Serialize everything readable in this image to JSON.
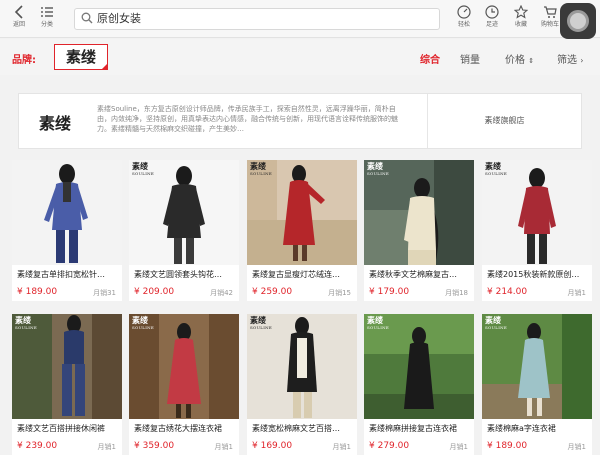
{
  "toolbar": {
    "back_label": "返回",
    "category_label": "分类",
    "right_buttons": [
      {
        "label": "轻松",
        "icon": "speedometer-icon"
      },
      {
        "label": "足迹",
        "icon": "clock-icon"
      },
      {
        "label": "收藏",
        "icon": "star-icon"
      },
      {
        "label": "购物车",
        "icon": "cart-icon"
      }
    ]
  },
  "search": {
    "query": "原创女装"
  },
  "filter": {
    "brand_label": "品牌",
    "brand_logo": "素缕",
    "sorts": [
      {
        "label": "综合",
        "active": true
      },
      {
        "label": "销量",
        "active": false
      },
      {
        "label": "价格",
        "active": false
      },
      {
        "label": "筛选",
        "active": false
      }
    ]
  },
  "shop": {
    "logo": "素缕",
    "description": "素缕Souline，东方复古原创设计师品牌，传承民族手工，探索自然性灵，远离浮躁华丽，简朴自由，内敛纯净，坚持原创，用真挚表达内心情感，融合传统与创新，用现代语言诠释传统服饰的魅力。素缕精髓与天然棉麻交织碰撞，产生美妙…",
    "store_link": "素缕旗舰店"
  },
  "products": [
    {
      "name": "素缕复古单排扣宽松针…",
      "price": "¥ 189.00",
      "sold": "月销31"
    },
    {
      "name": "素缕文艺圆领套头钩花…",
      "price": "¥ 209.00",
      "sold": "月销42"
    },
    {
      "name": "素缕复古显瘦灯芯绒连…",
      "price": "¥ 259.00",
      "sold": "月销15"
    },
    {
      "name": "素缕秋季文艺棉麻复古…",
      "price": "¥ 179.00",
      "sold": "月销18"
    },
    {
      "name": "素缕2015秋装新款原创…",
      "price": "¥ 214.00",
      "sold": "月销1"
    },
    {
      "name": "素缕文艺百搭拼接休闲裤",
      "price": "¥ 239.00",
      "sold": "月销1"
    },
    {
      "name": "素缕复古绣花大摆连衣裙",
      "price": "¥ 359.00",
      "sold": "月销1"
    },
    {
      "name": "素缕宽松棉麻文艺百搭…",
      "price": "¥ 169.00",
      "sold": "月销1"
    },
    {
      "name": "素缕棉麻拼接复古连衣裙",
      "price": "¥ 279.00",
      "sold": "月销1"
    },
    {
      "name": "素缕棉麻a字连衣裙",
      "price": "¥ 189.00",
      "sold": "月销1"
    }
  ],
  "watermark": {
    "brand": "素缕",
    "latin": "SOULINE"
  },
  "colors": {
    "accent": "#e0242b",
    "background": "#f2f2f2"
  }
}
